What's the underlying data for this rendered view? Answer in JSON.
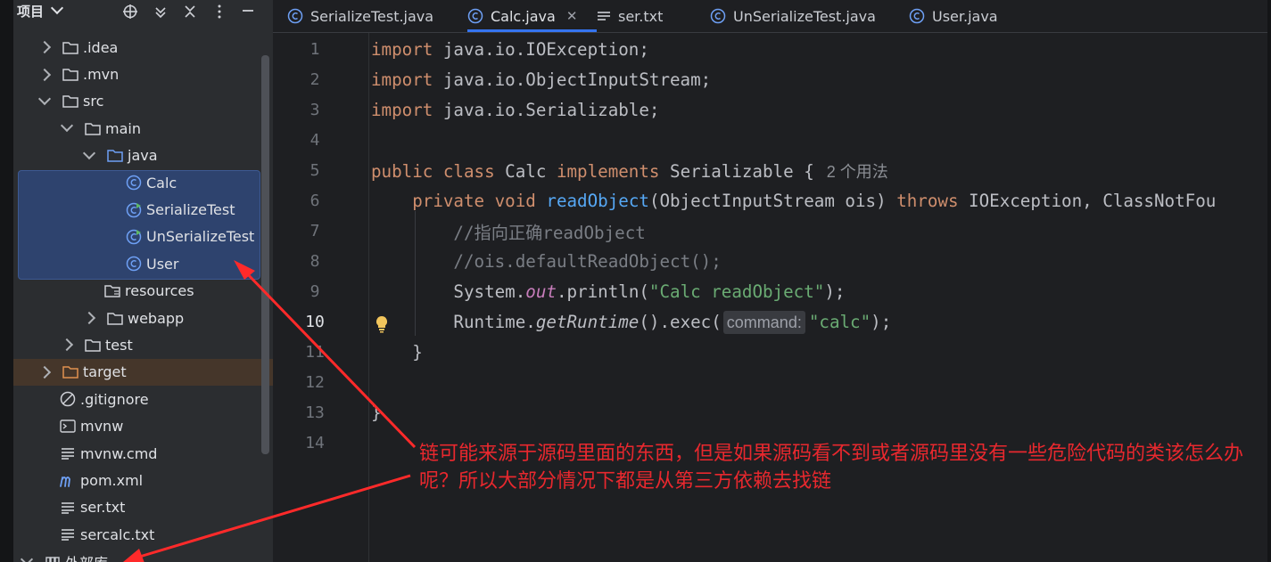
{
  "project_panel": {
    "title": "项目",
    "tree": [
      {
        "label": ".idea",
        "type": "folder",
        "arrow": "right"
      },
      {
        "label": ".mvn",
        "type": "folder",
        "arrow": "right"
      },
      {
        "label": "src",
        "type": "folder",
        "arrow": "down"
      },
      {
        "label": "main",
        "type": "folder",
        "arrow": "down"
      },
      {
        "label": "java",
        "type": "source-folder",
        "arrow": "down"
      },
      {
        "label": "Calc",
        "type": "class",
        "selected": true
      },
      {
        "label": "SerializeTest",
        "type": "runnable-class",
        "selected": true
      },
      {
        "label": "UnSerializeTest",
        "type": "runnable-class",
        "selected": true
      },
      {
        "label": "User",
        "type": "class",
        "selected": true
      },
      {
        "label": "resources",
        "type": "resources-folder"
      },
      {
        "label": "webapp",
        "type": "folder",
        "arrow": "right"
      },
      {
        "label": "test",
        "type": "folder",
        "arrow": "right"
      },
      {
        "label": "target",
        "type": "excluded-folder",
        "arrow": "right",
        "highlight": true
      },
      {
        "label": ".gitignore",
        "type": "ignore-file"
      },
      {
        "label": "mvnw",
        "type": "script-file"
      },
      {
        "label": "mvnw.cmd",
        "type": "text-file"
      },
      {
        "label": "pom.xml",
        "type": "maven-file"
      },
      {
        "label": "ser.txt",
        "type": "text-file"
      },
      {
        "label": "sercalc.txt",
        "type": "text-file"
      },
      {
        "label": "外部库",
        "type": "library",
        "arrow": "down"
      }
    ]
  },
  "tabs": [
    {
      "label": "SerializeTest.java",
      "icon": "class-icon"
    },
    {
      "label": "Calc.java",
      "icon": "class-icon",
      "active": true
    },
    {
      "label": "ser.txt",
      "icon": "text-file-icon"
    },
    {
      "label": "UnSerializeTest.java",
      "icon": "class-icon"
    },
    {
      "label": "User.java",
      "icon": "class-icon"
    }
  ],
  "editor": {
    "line_numbers": [
      "1",
      "2",
      "3",
      "4",
      "5",
      "6",
      "7",
      "8",
      "9",
      "10",
      "11",
      "12",
      "13",
      "14"
    ],
    "current_line": "10",
    "code": {
      "l1_kw": "import",
      "l1_rest": " java.io.IOException;",
      "l2_kw": "import",
      "l2_rest": " java.io.ObjectInputStream;",
      "l3_kw": "import",
      "l3_rest": " java.io.Serializable;",
      "l5_kw1": "public class",
      "l5_name": " Calc ",
      "l5_kw2": "implements",
      "l5_rest": " Serializable {",
      "l5_usage": "2 个用法",
      "l6_kw": "private void",
      "l6_fn": "readObject",
      "l6_params": "(ObjectInputStream ois) ",
      "l6_throws": "throws",
      "l6_rest": " IOException, ClassNotFou",
      "l7": "//指向正确readObject",
      "l8": "//ois.defaultReadObject();",
      "l9_a": "System.",
      "l9_field": "out",
      "l9_b": ".println(",
      "l9_str": "\"Calc readObject\"",
      "l9_c": ");",
      "l10_a": "Runtime.",
      "l10_fn": "getRuntime",
      "l10_b": "().exec(",
      "l10_hint": "command:",
      "l10_str": "\"calc\"",
      "l10_c": ");",
      "l11": "}",
      "l13": "}"
    }
  },
  "annotation": {
    "text": "链可能来源于源码里面的东西，但是如果源码看不到或者源码里没有一些危险代码的类该怎么办呢？所以大部分情况下都是从第三方依赖去找链",
    "color": "#e8282e"
  }
}
